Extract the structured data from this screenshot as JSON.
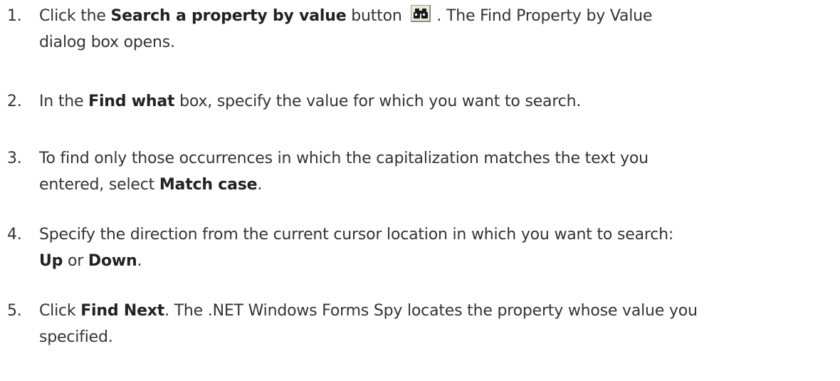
{
  "steps": [
    {
      "number": "1.",
      "parts": {
        "a": "Click the ",
        "b1": "Search a property by value",
        "c": " button ",
        "d": ". The Find Property by Value",
        "e": "dialog box opens."
      },
      "icon": "binoculars-icon"
    },
    {
      "number": "2.",
      "parts": {
        "a": "In the ",
        "b1": "Find what",
        "c": " box, specify the value for which you want to search."
      }
    },
    {
      "number": "3.",
      "parts": {
        "a": "To find only those occurrences in which the capitalization matches the text you",
        "b": "entered, select ",
        "b1": "Match case",
        "c": "."
      }
    },
    {
      "number": "4.",
      "parts": {
        "a": "Specify the direction from the current cursor location in which you want to search:",
        "b1": "Up",
        "c": " or ",
        "b2": "Down",
        "d": "."
      }
    },
    {
      "number": "5.",
      "parts": {
        "a": "Click ",
        "b1": "Find Next",
        "c": ". The .NET Windows Forms Spy locates the property whose value you",
        "d": "specified."
      }
    }
  ]
}
